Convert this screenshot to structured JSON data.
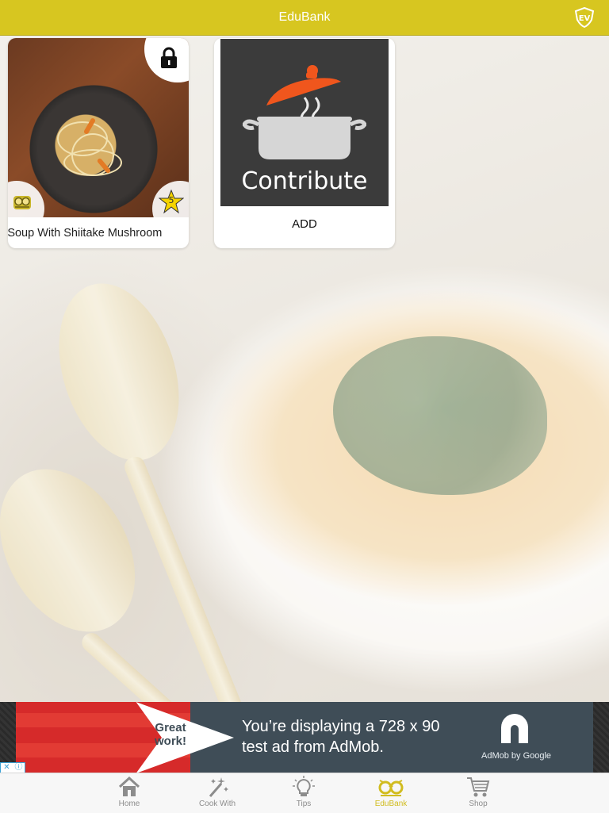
{
  "colors": {
    "top_bar": "#d7c620",
    "active_tab": "#d1bc1f",
    "inactive_tab": "#8c8c8c",
    "contribute_panel": "#3b3b3b",
    "pot_lid": "#f0561d",
    "ad_background": "#3f4d57",
    "ad_red": "#d62a2a"
  },
  "header": {
    "title": "EduBank",
    "logo_icon": "ev-shield-logo-icon"
  },
  "cards": [
    {
      "type": "recipe",
      "name": "le Soup With Shiitake Mushroom",
      "lock_icon": "lock-icon",
      "badge_icon": "owl-glasses-icon",
      "rating_icon": "star-icon",
      "rating": "5"
    },
    {
      "type": "add",
      "image_text": "Contribute",
      "label": "ADD",
      "icon": "cooking-pot-icon"
    }
  ],
  "ad": {
    "badge_text": "Great work!",
    "line1": "You’re displaying a 728 x 90",
    "line2": "test ad from AdMob.",
    "brand": "AdMob by Google",
    "close_icons": [
      "close-icon",
      "info-icon"
    ]
  },
  "tabs": [
    {
      "label": "Home",
      "icon": "home-icon",
      "active": false
    },
    {
      "label": "Cook With",
      "icon": "magic-wand-icon",
      "active": false
    },
    {
      "label": "Tips",
      "icon": "lightbulb-icon",
      "active": false
    },
    {
      "label": "EduBank",
      "icon": "owl-glasses-icon",
      "active": true
    },
    {
      "label": "Shop",
      "icon": "shopping-cart-icon",
      "active": false
    }
  ]
}
